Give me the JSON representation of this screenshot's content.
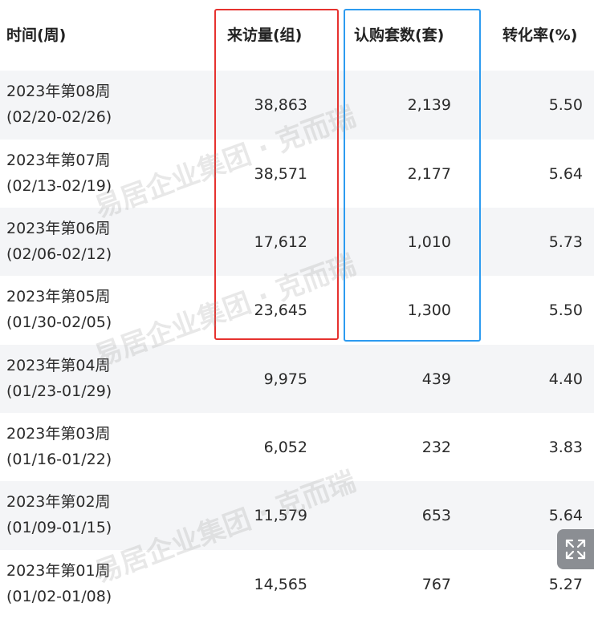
{
  "headers": [
    "时间(周)",
    "来访量(组)",
    "认购套数(套)",
    "转化率(%)"
  ],
  "rows": [
    {
      "week": "2023年第08周",
      "range": "(02/20-02/26)",
      "visits": "38,863",
      "subs": "2,139",
      "rate": "5.50"
    },
    {
      "week": "2023年第07周",
      "range": "(02/13-02/19)",
      "visits": "38,571",
      "subs": "2,177",
      "rate": "5.64"
    },
    {
      "week": "2023年第06周",
      "range": "(02/06-02/12)",
      "visits": "17,612",
      "subs": "1,010",
      "rate": "5.73"
    },
    {
      "week": "2023年第05周",
      "range": "(01/30-02/05)",
      "visits": "23,645",
      "subs": "1,300",
      "rate": "5.50"
    },
    {
      "week": "2023年第04周",
      "range": "(01/23-01/29)",
      "visits": "9,975",
      "subs": "439",
      "rate": "4.40"
    },
    {
      "week": "2023年第03周",
      "range": "(01/16-01/22)",
      "visits": "6,052",
      "subs": "232",
      "rate": "3.83"
    },
    {
      "week": "2023年第02周",
      "range": "(01/09-01/15)",
      "visits": "11,579",
      "subs": "653",
      "rate": "5.64"
    },
    {
      "week": "2023年第01周",
      "range": "(01/02-01/08)",
      "visits": "14,565",
      "subs": "767",
      "rate": "5.27"
    }
  ],
  "watermarks": [
    "易居企业集团 · 克而瑞",
    "易居企业集团 · 克而瑞",
    "易居企业集团 · 克而瑞"
  ],
  "colors": {
    "highlight_visits": "#e6322f",
    "highlight_subs": "#2d9bf0",
    "row_stripe": "#f4f5f7"
  },
  "expand_icon": "expand-icon"
}
